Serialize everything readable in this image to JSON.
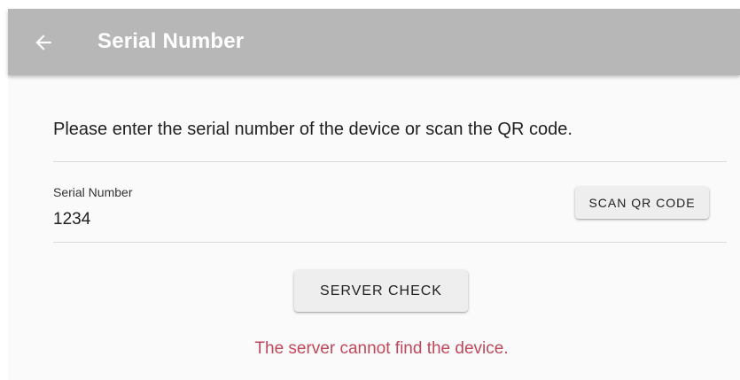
{
  "app_bar": {
    "title": "Serial Number",
    "back_icon": "arrow-left-icon",
    "background_color": "#b7b7b7"
  },
  "form": {
    "instruction": "Please enter the serial number of the device or scan the QR code.",
    "serial_label": "Serial Number",
    "serial_value": "1234",
    "scan_button_label": "SCAN QR CODE",
    "server_check_button_label": "SERVER CHECK",
    "error_message": "The server cannot find the device.",
    "error_color": "#c0485a"
  }
}
